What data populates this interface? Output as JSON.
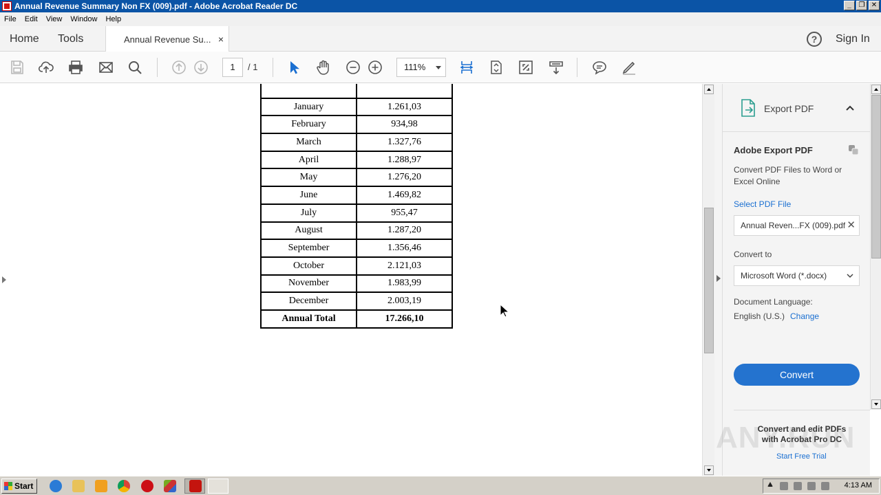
{
  "window": {
    "title": "Annual Revenue Summary Non FX (009).pdf - Adobe Acrobat Reader DC",
    "min": "_",
    "max": "❐",
    "close": "✕"
  },
  "menu": [
    "File",
    "Edit",
    "View",
    "Window",
    "Help"
  ],
  "tabs": {
    "home": "Home",
    "tools": "Tools",
    "document": "Annual Revenue Su...",
    "close": "×",
    "sign_in": "Sign In",
    "help": "?"
  },
  "toolbar": {
    "page_current": "1",
    "page_total": "/ 1",
    "zoom": "111%"
  },
  "table": {
    "rows": [
      {
        "month": "January",
        "value": "1.261,03"
      },
      {
        "month": "February",
        "value": "934,98"
      },
      {
        "month": "March",
        "value": "1.327,76"
      },
      {
        "month": "April",
        "value": "1.288,97"
      },
      {
        "month": "May",
        "value": "1.276,20"
      },
      {
        "month": "June",
        "value": "1.469,82"
      },
      {
        "month": "July",
        "value": "955,47"
      },
      {
        "month": "August",
        "value": "1.287,20"
      },
      {
        "month": "September",
        "value": "1.356,46"
      },
      {
        "month": "October",
        "value": "2.121,03"
      },
      {
        "month": "November",
        "value": "1.983,99"
      },
      {
        "month": "December",
        "value": "2.003,19"
      }
    ],
    "total_label": "Annual Total",
    "total_value": "17.266,10"
  },
  "panel": {
    "title": "Export PDF",
    "heading": "Adobe Export PDF",
    "description": "Convert PDF Files to Word or Excel Online",
    "select_label": "Select PDF File",
    "file_name": "Annual Reven...FX (009).pdf",
    "clear": "✕",
    "convert_to_label": "Convert to",
    "convert_to_value": "Microsoft Word (*.docx)",
    "doc_language_label": "Document Language:",
    "doc_language_value": "English (U.S.)",
    "change_link": "Change",
    "convert_button": "Convert",
    "promo": "Convert and edit PDFs with Acrobat Pro DC",
    "trial_link": "Start Free Trial"
  },
  "watermark": "ANY.RUN",
  "taskbar": {
    "start": "Start",
    "clock": "4:13 AM"
  },
  "colors": {
    "titlebar": "#0b54a6",
    "accent_blue": "#2473cf",
    "link_blue": "#1a6fd1"
  }
}
